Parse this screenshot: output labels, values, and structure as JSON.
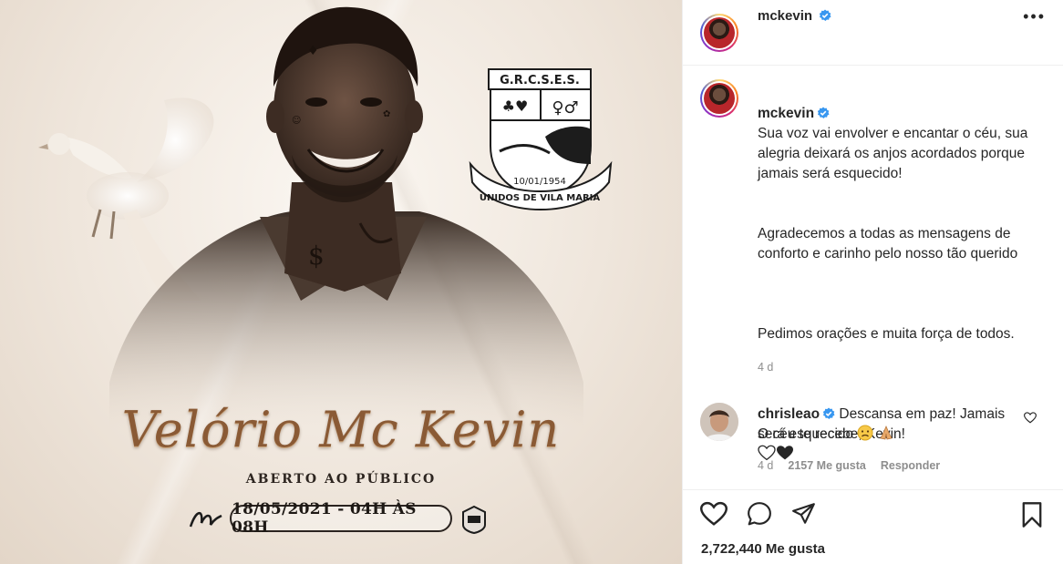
{
  "post": {
    "image": {
      "emblem": {
        "acronym": "G.R.C.S.E.S.",
        "date": "10/01/1954",
        "name": "UNIDOS DE VILA MARIA"
      },
      "title": "Velório Mc Kevin",
      "subtitle": "ABERTO AO PÚBLICO",
      "date_time": "18/05/2021 - 04H ÀS 08H"
    }
  },
  "header": {
    "username": "mckevin",
    "avatar": "profile-avatar",
    "verified_icon": "verified-badge-icon",
    "more_icon": "more-options-icon"
  },
  "caption": {
    "username": "mckevin",
    "para1": "Sua voz vai envolver e encantar o céu, sua alegria deixará os anjos acordados porque jamais será esquecido!",
    "para2": "Agradecemos a todas as mensagens de conforto e carinho pelo nosso tão querido",
    "para3": "Pedimos orações e muita força de todos.",
    "para4": "O céu te recebe, Kevin!",
    "time": "4 d"
  },
  "comment": {
    "username": "chrisleao",
    "text": "Descansa em paz! Jamais será esquecido",
    "time": "4 d",
    "likes": "2157 Me gusta",
    "reply": "Responder"
  },
  "actions": {
    "like_icon": "heart-icon",
    "comment_icon": "comment-icon",
    "share_icon": "share-icon",
    "save_icon": "bookmark-icon"
  },
  "likes_count": "2,722,440 Me gusta",
  "colors": {
    "verified": "#3897f0",
    "muted": "#8e8e8e",
    "text": "#262626",
    "title_gold": "#8a5a35"
  }
}
